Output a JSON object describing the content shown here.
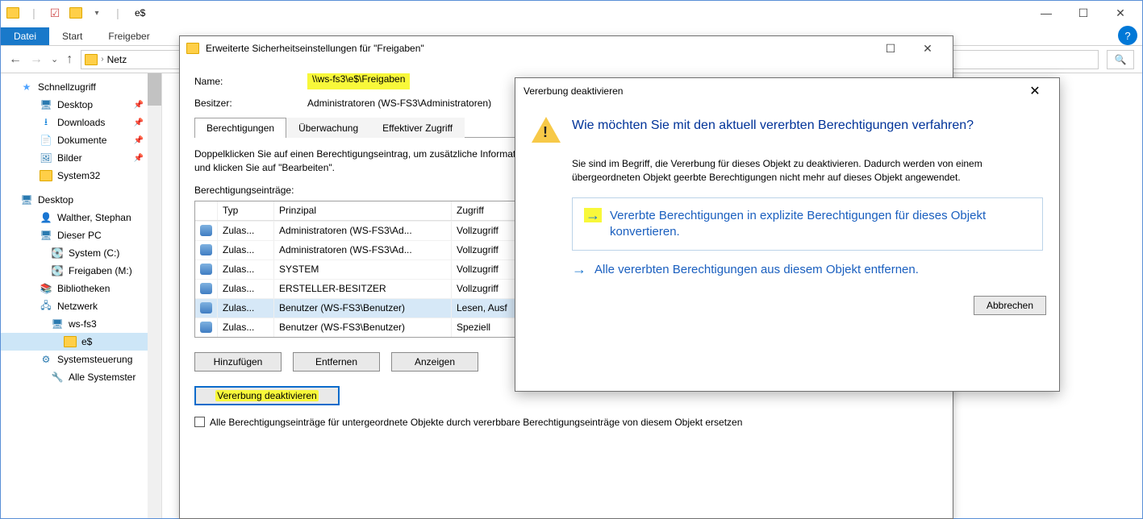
{
  "explorer": {
    "title": "e$",
    "ribbon": {
      "file": "Datei",
      "start": "Start",
      "share": "Freigeber"
    },
    "breadcrumb_prefix": "Netz",
    "tree": {
      "quick": "Schnellzugriff",
      "desktop": "Desktop",
      "downloads": "Downloads",
      "documents": "Dokumente",
      "pictures": "Bilder",
      "system32": "System32",
      "desktop2": "Desktop",
      "user": "Walther, Stephan",
      "thispc": "Dieser PC",
      "drive_c": "System (C:)",
      "drive_m": "Freigaben (M:)",
      "libraries": "Bibliotheken",
      "network": "Netzwerk",
      "host": "ws-fs3",
      "share": "e$",
      "controlpanel": "Systemsteuerung",
      "allsettings": "Alle Systemster"
    }
  },
  "security": {
    "title": "Erweiterte Sicherheitseinstellungen für \"Freigaben\"",
    "name_label": "Name:",
    "name_value": "\\\\ws-fs3\\e$\\Freigaben",
    "owner_label": "Besitzer:",
    "owner_value": "Administratoren (WS-FS3\\Administratoren)",
    "tabs": {
      "perm": "Berechtigungen",
      "audit": "Überwachung",
      "eff": "Effektiver Zugriff"
    },
    "instructions": "Doppelklicken Sie auf einen Berechtigungseintrag, um zusätzliche Informationen zu erhalten. Wählen Sie zum Ändern eines Berechtigungseintrags den Eintrag aus, und klicken Sie auf \"Bearbeiten\".",
    "entries_label": "Berechtigungseinträge:",
    "columns": {
      "type": "Typ",
      "principal": "Prinzipal",
      "access": "Zugriff"
    },
    "rows": [
      {
        "type": "Zulas...",
        "principal": "Administratoren (WS-FS3\\Ad...",
        "access": "Vollzugriff"
      },
      {
        "type": "Zulas...",
        "principal": "Administratoren (WS-FS3\\Ad...",
        "access": "Vollzugriff"
      },
      {
        "type": "Zulas...",
        "principal": "SYSTEM",
        "access": "Vollzugriff"
      },
      {
        "type": "Zulas...",
        "principal": "ERSTELLER-BESITZER",
        "access": "Vollzugriff"
      },
      {
        "type": "Zulas...",
        "principal": "Benutzer (WS-FS3\\Benutzer)",
        "access": "Lesen, Ausf"
      },
      {
        "type": "Zulas...",
        "principal": "Benutzer (WS-FS3\\Benutzer)",
        "access": "Speziell"
      }
    ],
    "buttons": {
      "add": "Hinzufügen",
      "remove": "Entfernen",
      "view": "Anzeigen",
      "disable_inherit": "Vererbung deaktivieren"
    },
    "replace_cb": "Alle Berechtigungseinträge für untergeordnete Objekte durch vererbbare Berechtigungseinträge von diesem Objekt ersetzen"
  },
  "confirm": {
    "title": "Vererbung deaktivieren",
    "question": "Wie möchten Sie mit den aktuell vererbten Berechtigungen verfahren?",
    "desc": "Sie sind im Begriff, die Vererbung für dieses Objekt zu deaktivieren. Dadurch werden von einem übergeordneten Objekt geerbte Berechtigungen nicht mehr auf dieses Objekt angewendet.",
    "opt1": "Vererbte Berechtigungen in explizite Berechtigungen für dieses Objekt konvertieren.",
    "opt2": "Alle vererbten Berechtigungen aus diesem Objekt entfernen.",
    "cancel": "Abbrechen"
  }
}
